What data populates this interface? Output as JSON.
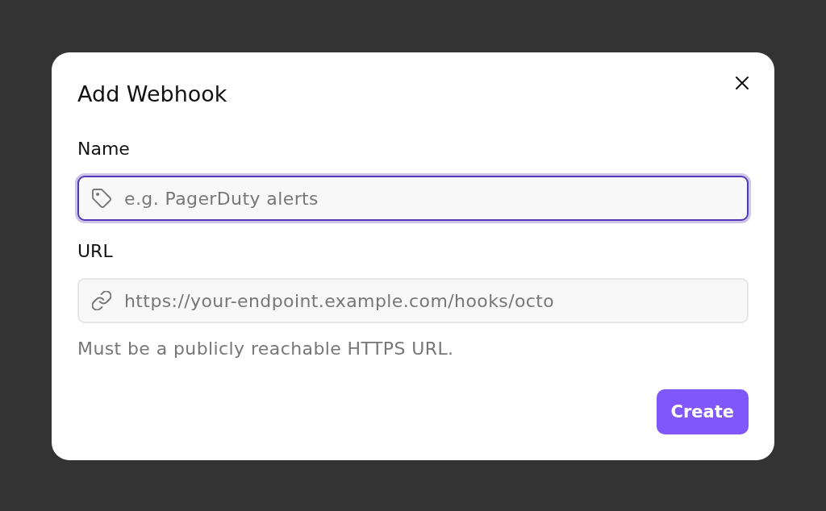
{
  "dialog": {
    "title": "Add Webhook",
    "fields": [
      {
        "label": "Name",
        "placeholder": "e.g. PagerDuty alerts",
        "focused": true
      },
      {
        "label": "URL",
        "placeholder": "https://your-endpoint.example.com/hooks/octo",
        "focused": false,
        "hint": "Must be a publicly reachable HTTPS URL."
      }
    ],
    "buttons": [
      {
        "label": "Create"
      }
    ]
  }
}
